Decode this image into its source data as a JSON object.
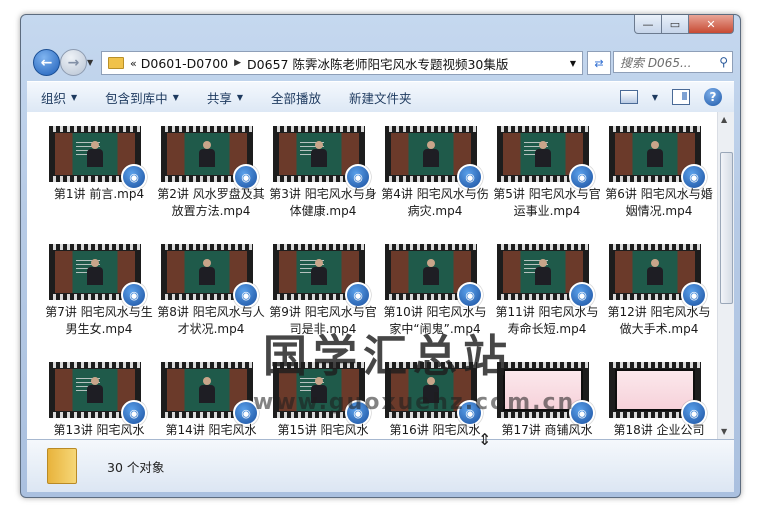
{
  "window": {
    "address_parts": [
      "D0601-D0700",
      "D0657 陈霁冰陈老师阳宅风水专题视频30集版"
    ],
    "address_prefix": "«",
    "search_placeholder": "搜索 D065...",
    "caption_buttons": {
      "minimize": "—",
      "maximize": "▭",
      "close": "✕"
    }
  },
  "toolbar": {
    "organize": "组织",
    "include_in_library": "包含到库中",
    "share": "共享",
    "play_all": "全部播放",
    "new_folder": "新建文件夹"
  },
  "files": [
    {
      "name": "第1讲 前言.mp4",
      "kind": "board"
    },
    {
      "name": "第2讲 风水罗盘及其放置方法.mp4",
      "kind": "board"
    },
    {
      "name": "第3讲 阳宅风水与身体健康.mp4",
      "kind": "board"
    },
    {
      "name": "第4讲 阳宅风水与伤病灾.mp4",
      "kind": "board"
    },
    {
      "name": "第5讲 阳宅风水与官运事业.mp4",
      "kind": "board"
    },
    {
      "name": "第6讲 阳宅风水与婚姻情况.mp4",
      "kind": "board"
    },
    {
      "name": "第7讲 阳宅风水与生男生女.mp4",
      "kind": "board"
    },
    {
      "name": "第8讲 阳宅风水与人才状况.mp4",
      "kind": "board"
    },
    {
      "name": "第9讲 阳宅风水与官司是非.mp4",
      "kind": "board"
    },
    {
      "name": "第10讲 阳宅风水与家中“闹鬼”.mp4",
      "kind": "board"
    },
    {
      "name": "第11讲 阳宅风水与寿命长短.mp4",
      "kind": "board"
    },
    {
      "name": "第12讲 阳宅风水与做大手术.mp4",
      "kind": "board"
    },
    {
      "name": "第13讲 阳宅风水",
      "kind": "board"
    },
    {
      "name": "第14讲 阳宅风水",
      "kind": "board"
    },
    {
      "name": "第15讲 阳宅风水",
      "kind": "board"
    },
    {
      "name": "第16讲 阳宅风水",
      "kind": "board"
    },
    {
      "name": "第17讲 商铺风水",
      "kind": "slide"
    },
    {
      "name": "第18讲 企业公司",
      "kind": "slide"
    }
  ],
  "watermark": {
    "text": "国学汇总站",
    "url": "www.guoxuehz.com.cn"
  },
  "status": {
    "count_text": "30 个对象"
  }
}
